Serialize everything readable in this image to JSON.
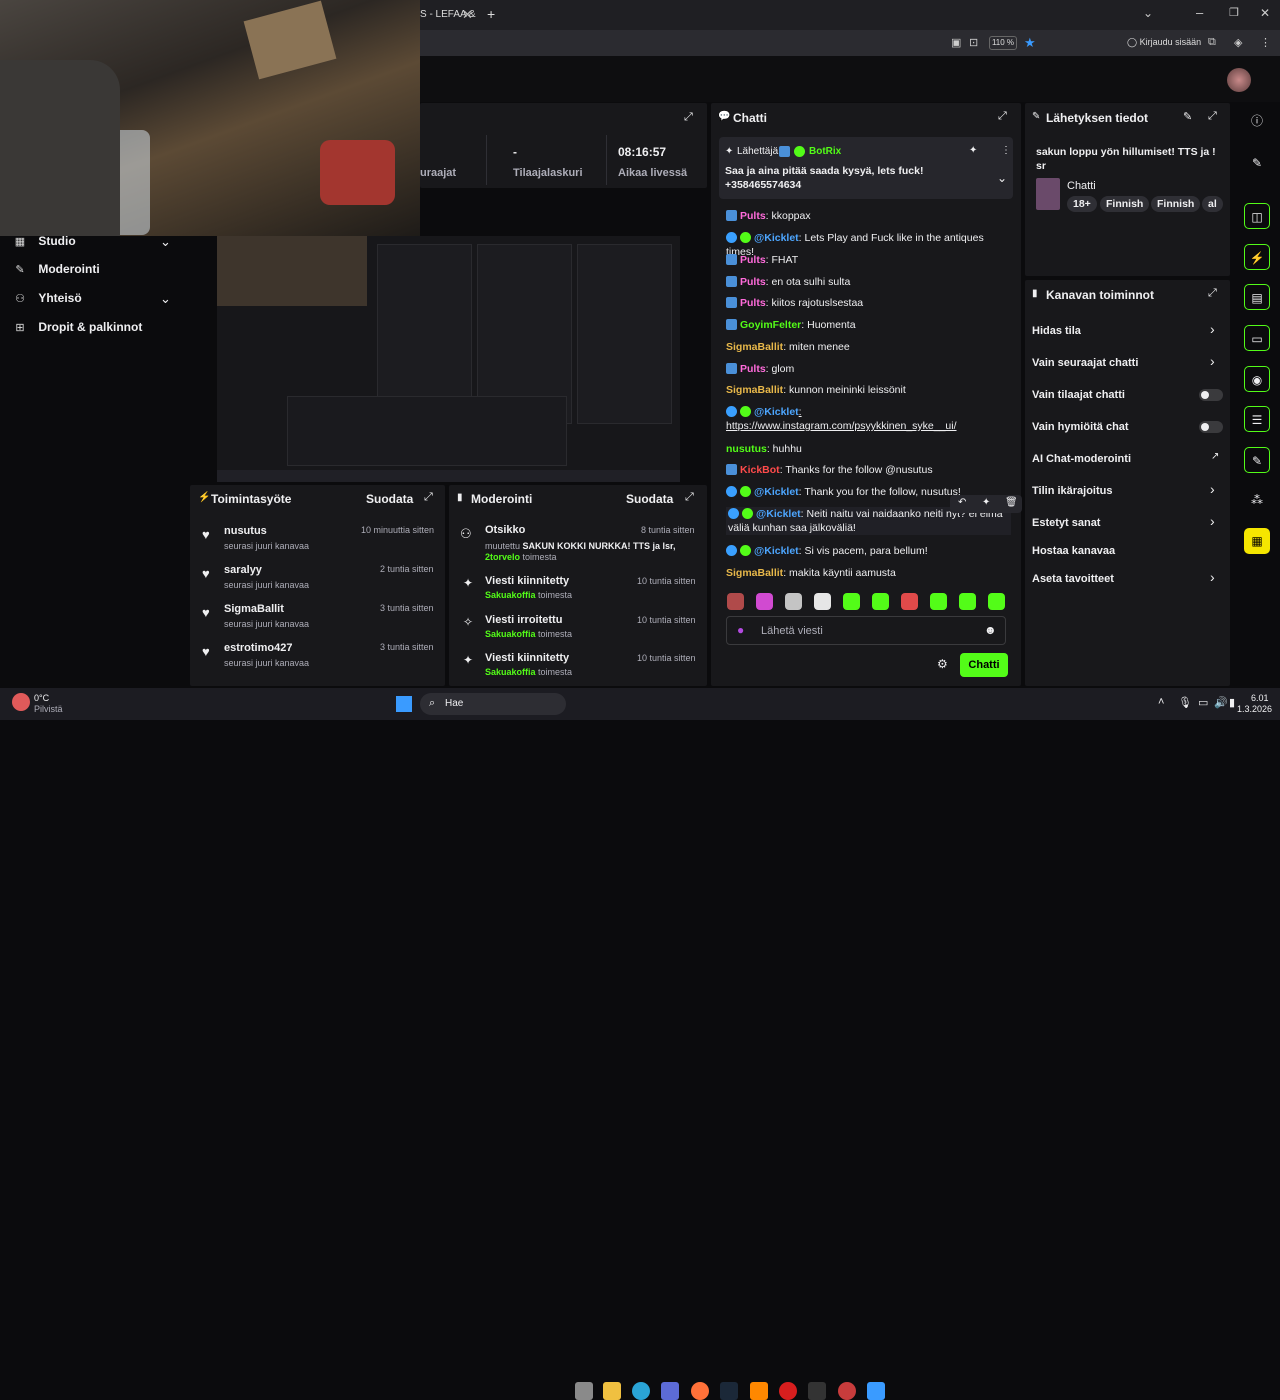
{
  "browser": {
    "tab_title": "S - LEFAA &",
    "new_tab": "+",
    "zoom": "110 %",
    "signin": "Kirjaudu sisään"
  },
  "sidebar_nav": {
    "items": [
      {
        "label": "Studio"
      },
      {
        "label": "Moderointi"
      },
      {
        "label": "Yhteisö"
      },
      {
        "label": "Dropit & palkinnot"
      }
    ]
  },
  "stats": {
    "followers_label": "uraajat",
    "subs_value": "-",
    "subs_label": "Tilaajalaskuri",
    "uptime_value": "08:16:57",
    "uptime_label": "Aikaa livessä"
  },
  "activity": {
    "title": "Toimintasyöte",
    "filter": "Suodata",
    "items": [
      {
        "user": "nusutus",
        "time": "10 minuuttia sitten",
        "action": "seurasi juuri kanavaa"
      },
      {
        "user": "saralyy",
        "time": "2 tuntia sitten",
        "action": "seurasi juuri kanavaa"
      },
      {
        "user": "SigmaBallit",
        "time": "3 tuntia sitten",
        "action": "seurasi juuri kanavaa"
      },
      {
        "user": "estrotimo427",
        "time": "3 tuntia sitten",
        "action": "seurasi juuri kanavaa"
      }
    ]
  },
  "moderation": {
    "title": "Moderointi",
    "filter": "Suodata",
    "items": [
      {
        "title": "Otsikko",
        "time": "8 tuntia sitten",
        "desc_prefix": "muutettu ",
        "desc_bold": "SAKUN KOKKI NURKKA! TTS ja lsr,",
        "by": "2torvelo",
        "by_suffix": " toimesta"
      },
      {
        "title": "Viesti kiinnitetty",
        "time": "10 tuntia sitten",
        "by": "Sakuakoffia",
        "by_suffix": " toimesta"
      },
      {
        "title": "Viesti irroitettu",
        "time": "10 tuntia sitten",
        "by": "Sakuakoffia",
        "by_suffix": " toimesta"
      },
      {
        "title": "Viesti kiinnitetty",
        "time": "10 tuntia sitten",
        "by": "Sakuakoffia",
        "by_suffix": " toimesta"
      }
    ]
  },
  "chat": {
    "title": "Chatti",
    "pinned": {
      "sender_label": "Lähettäjä",
      "sender": "BotRix",
      "text": "Saa ja aina pitää saada kysyä, lets fuck! +358465574634"
    },
    "messages": [
      {
        "user": "Pults",
        "text": ": kkoppax",
        "color": "#ff6bdb"
      },
      {
        "user": "@Kicklet",
        "text": ": Lets Play and Fuck like in the antiques times!",
        "color": "#4da6ff"
      },
      {
        "user": "Pults",
        "text": ": FHAT",
        "color": "#ff6bdb"
      },
      {
        "user": "Pults",
        "text": ": en ota sulhi sulta",
        "color": "#ff6bdb"
      },
      {
        "user": "Pults",
        "text": ": kiitos rajotuslsestaa",
        "color": "#ff6bdb"
      },
      {
        "user": "GoyimFelter",
        "text": ": Huomenta",
        "color": "#53fc18"
      },
      {
        "user": "SigmaBallit",
        "text": ": miten menee",
        "color": "#e8b84a"
      },
      {
        "user": "Pults",
        "text": ": glom",
        "color": "#ff6bdb"
      },
      {
        "user": "SigmaBallit",
        "text": ": kunnon meininki leissönit",
        "color": "#e8b84a"
      },
      {
        "user": "@Kicklet",
        "text": ": https://www.instagram.com/psyykkinen_syke__ui/",
        "color": "#4da6ff"
      },
      {
        "user": "nusutus",
        "text": ": huhhu",
        "color": "#53fc18"
      },
      {
        "user": "KickBot",
        "text": ": Thanks for the follow @nusutus",
        "color": "#ff4b4b"
      },
      {
        "user": "@Kicklet",
        "text": ": Thank you for the follow, nusutus!",
        "color": "#4da6ff"
      },
      {
        "user": "@Kicklet",
        "text": ": Neiti naitu vai naidaanko neiti nyt? ei eima väliä kunhan saa jälkoväliä!",
        "color": "#4da6ff"
      },
      {
        "user": "@Kicklet",
        "text": ": Si vis pacem, para bellum!",
        "color": "#4da6ff"
      },
      {
        "user": "SigmaBallit",
        "text": ": makita käyntii aamusta",
        "color": "#e8b84a"
      }
    ],
    "input_placeholder": "Lähetä viesti",
    "send": "Chatti"
  },
  "stream_info": {
    "title": "Lähetyksen tiedot",
    "stream_title": "sakun loppu yön hillumiset! TTS ja ! sr",
    "category": "Chatti",
    "tags": [
      "18+",
      "Finnish",
      "Finnish",
      "al"
    ]
  },
  "channel_actions": {
    "title": "Kanavan toiminnot",
    "items": [
      {
        "label": "Hidas tila",
        "control": "chevron"
      },
      {
        "label": "Vain seuraajat chatti",
        "control": "chevron"
      },
      {
        "label": "Vain tilaajat chatti",
        "control": "toggle"
      },
      {
        "label": "Vain hymiöitä chat",
        "control": "toggle"
      },
      {
        "label": "AI Chat-moderointi",
        "control": "external"
      },
      {
        "label": "Tilin ikärajoitus",
        "control": "chevron"
      },
      {
        "label": "Estetyt sanat",
        "control": "chevron"
      },
      {
        "label": "Hostaa kanavaa",
        "control": "none"
      },
      {
        "label": "Aseta tavoitteet",
        "control": "chevron"
      }
    ]
  },
  "taskbar": {
    "weather_temp": "0°C",
    "weather_desc": "Pilvistä",
    "search": "Hae",
    "time": "6.01",
    "date": "1.3.2026"
  },
  "colors": {
    "accent": "#53fc18",
    "panel": "#18181b",
    "bg": "#0b0b0d"
  }
}
